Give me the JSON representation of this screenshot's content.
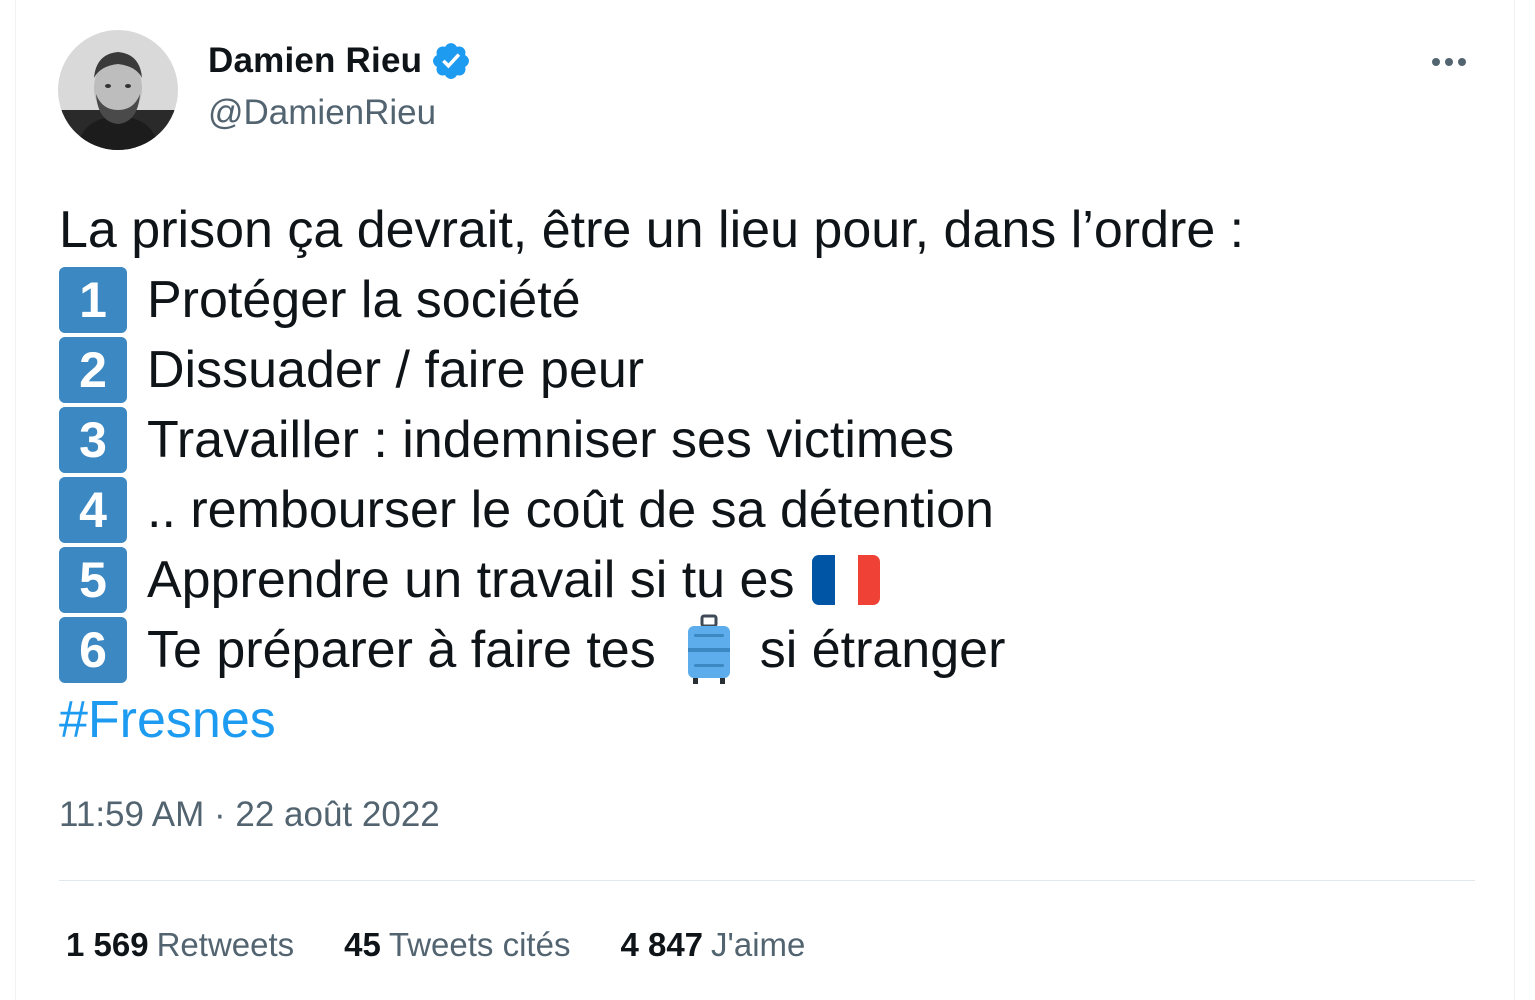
{
  "author": {
    "name": "Damien Rieu",
    "handle": "@DamienRieu",
    "verified": true,
    "avatar_icon": "profile-photo"
  },
  "tweet": {
    "intro": "La prison ça devrait, être un lieu pour, dans l’ordre :",
    "items": [
      {
        "num": "1",
        "text": "Protéger la société"
      },
      {
        "num": "2",
        "text": "Dissuader / faire peur"
      },
      {
        "num": "3",
        "text": "Travailler : indemniser ses victimes"
      },
      {
        "num": "4",
        "text": ".. rembourser le coût de sa détention"
      },
      {
        "num": "5",
        "text": "Apprendre un travail si tu es",
        "emoji": "flag-france-icon"
      },
      {
        "num": "6",
        "text_before": "Te préparer à faire tes",
        "emoji": "suitcase-icon",
        "text_after": "si étranger"
      }
    ],
    "hashtag": "#Fresnes",
    "timestamp": "11:59 AM · 22 août 2022"
  },
  "stats": {
    "retweets_count": "1 569",
    "retweets_label": "Retweets",
    "quotes_count": "45",
    "quotes_label": "Tweets cités",
    "likes_count": "4 847",
    "likes_label": "J'aime"
  },
  "colors": {
    "accent": "#1d9bf0",
    "keycap": "#3b88c3",
    "secondary_text": "#536471"
  }
}
